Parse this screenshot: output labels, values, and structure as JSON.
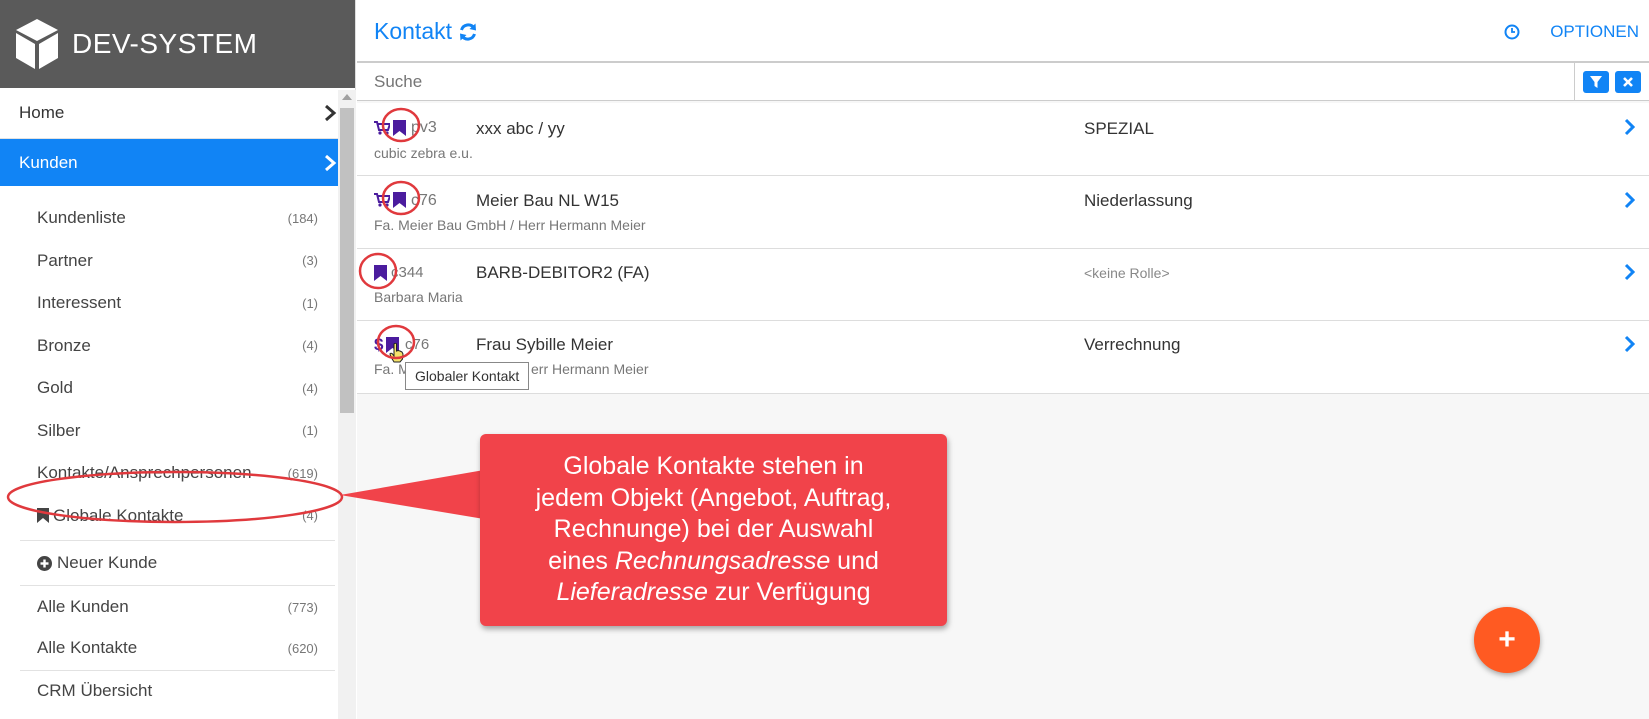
{
  "brand": {
    "title": "DEV-SYSTEM"
  },
  "nav": {
    "home": "Home",
    "kunden": "Kunden",
    "items": [
      {
        "label": "Kundenliste",
        "count": "(184)"
      },
      {
        "label": "Partner",
        "count": "(3)"
      },
      {
        "label": "Interessent",
        "count": "(1)"
      },
      {
        "label": "Bronze",
        "count": "(4)"
      },
      {
        "label": "Gold",
        "count": "(4)"
      },
      {
        "label": "Silber",
        "count": "(1)"
      },
      {
        "label": "Kontakte/Ansprechpersonen",
        "count": "(619)"
      },
      {
        "label": "Globale Kontakte",
        "count": "(4)"
      }
    ],
    "new_customer": "Neuer Kunde",
    "all_customers": {
      "label": "Alle Kunden",
      "count": "(773)"
    },
    "all_contacts": {
      "label": "Alle Kontakte",
      "count": "(620)"
    },
    "crm": "CRM Übersicht"
  },
  "header": {
    "title": "Kontakt",
    "options": "OPTIONEN"
  },
  "search": {
    "placeholder": "Suche"
  },
  "contacts": [
    {
      "code": "pv3",
      "name": "xxx abc / yy",
      "sub": "cubic zebra e.u.",
      "role": "SPEZIAL"
    },
    {
      "code": "c76",
      "name": "Meier Bau NL W15",
      "sub": "Fa. Meier Bau GmbH / Herr Hermann Meier",
      "role": "Niederlassung"
    },
    {
      "code": "c344",
      "name": "BARB-DEBITOR2 (FA)",
      "sub": "Barbara Maria",
      "role": "<keine Rolle>"
    },
    {
      "code": "c76",
      "name": "Frau Sybille Meier",
      "sub": "Fa. M",
      "sub2": "err Hermann Meier",
      "role": "Verrechnung"
    }
  ],
  "tooltip": "Globaler Kontakt",
  "callout": {
    "line1": "Globale Kontakte stehen in",
    "line2": "jedem Objekt (Angebot, Auftrag,",
    "line3": "Rechnunge) bei der Auswahl",
    "line4_pre": "eines ",
    "line4_em": "Rechnungsadresse",
    "line4_post": " und",
    "line5_em": "Lieferadresse",
    "line5_post": " zur Verfügung"
  },
  "fab": {
    "label": "+"
  },
  "colors": {
    "accent": "#1184f5",
    "brand_bg": "#5a5a5a",
    "callout": "#f1434a",
    "fab": "#ff5a22",
    "bookmark": "#4b1c9e",
    "highlight": "#e0393d"
  }
}
